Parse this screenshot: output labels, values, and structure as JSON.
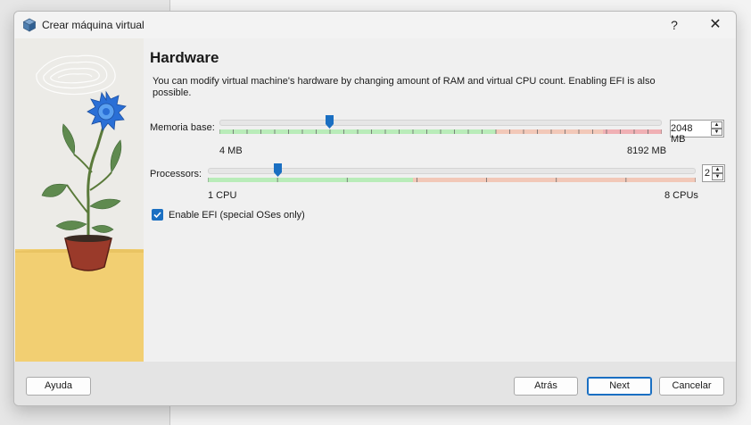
{
  "window": {
    "title": "Crear máquina virtual",
    "help_symbol": "?",
    "close_symbol": "✕",
    "app_icon": "virtualbox-cube-icon"
  },
  "page": {
    "heading": "Hardware",
    "description": "You can modify virtual machine's hardware by changing amount of RAM and virtual CPU count. Enabling EFI is also possible."
  },
  "memory": {
    "label": "Memoria base:",
    "value": "2048",
    "unit": "MB",
    "min_label": "4 MB",
    "max_label": "8192 MB",
    "min": 4,
    "max": 8192,
    "current": 2048
  },
  "processors": {
    "label": "Processors:",
    "value": "2",
    "min_label": "1 CPU",
    "max_label": "8 CPUs",
    "min": 1,
    "max": 8,
    "current": 2
  },
  "efi": {
    "label": "Enable EFI (special OSes only)",
    "checked": true
  },
  "buttons": {
    "help": "Ayuda",
    "back": "Atrás",
    "next": "Next",
    "cancel": "Cancelar"
  },
  "colors": {
    "slider_ok": "#b9ecb9",
    "slider_warn": "#f2c8b8",
    "slider_bad": "#f0b0b4",
    "accent": "#1a6fc2"
  }
}
